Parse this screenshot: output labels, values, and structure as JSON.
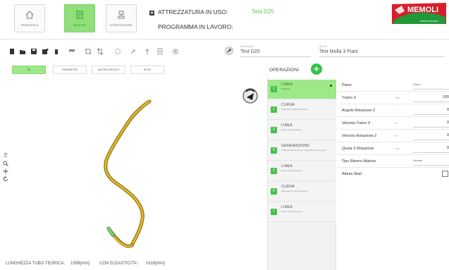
{
  "header": {
    "buttons": [
      {
        "label": "PRINCIPALE",
        "icon": "home-icon",
        "active": false
      },
      {
        "label": "RICETTE",
        "icon": "recipe-icon",
        "active": true
      },
      {
        "label": "ATTREZZATURE",
        "icon": "tooling-icon",
        "active": false
      }
    ],
    "tooling_label": "ATTREZZATURA IN USO:",
    "tooling_value": "Test D25",
    "program_label": "PROGRAMMA IN LAVORO:",
    "program_value": "",
    "logo_text": "MEMOLI",
    "logo_sub": "www.memoli.it",
    "accent": "#8fe07a"
  },
  "toolbar": {
    "icons": [
      "new-icon",
      "open-icon",
      "save-icon",
      "save-as-icon",
      "delete-icon",
      "ruler-icon",
      "crop-icon",
      "sort-icon",
      "rotate-icon",
      "pin-icon",
      "upload-icon",
      "copy-icon",
      "settings-icon"
    ],
    "tooling_field_label": "Attrezzatura",
    "tooling_field_value": "Test D25",
    "recipe_field_label": "Ricetta",
    "recipe_field_value": "Test Molla 3 Piani"
  },
  "subtabs": [
    "3D",
    "PARAMETRI",
    "VALORI DEFAULT",
    "NOTE"
  ],
  "canvas": {
    "length_label": "LUNGHEZZA TUBO TEORICA:",
    "length_value": "1599[mm]",
    "elastic_label": "CON ELEASTICITA':",
    "elastic_value": "1616[mm]"
  },
  "operations": {
    "title": "OPERAZIONI",
    "items": [
      {
        "n": "1",
        "name": "LINEA",
        "sub": "Generale",
        "active": true
      },
      {
        "n": "2",
        "name": "CURVA",
        "sub": "Parametri curva Operazione",
        "active": false
      },
      {
        "n": "3",
        "name": "LINEA",
        "sub": "Parametri Operazione",
        "active": false
      },
      {
        "n": "4",
        "name": "GENERAZIONE",
        "sub": "Posizione Generazione Programma a parametri",
        "active": false
      },
      {
        "n": "5",
        "name": "LINEA",
        "sub": "Parametri Operazione",
        "active": false
      },
      {
        "n": "6",
        "name": "CURVA",
        "sub": "Parametri curva Operazione",
        "active": false
      },
      {
        "n": "7",
        "name": "LINEA",
        "sub": "Parametri Operazione",
        "active": false
      }
    ]
  },
  "properties": [
    {
      "label": "Piano",
      "unit": "",
      "value": "",
      "select": "Piano 1"
    },
    {
      "label": "Traino X",
      "unit": "mm",
      "value": "100"
    },
    {
      "label": "Angolo Rotazione Z",
      "unit": "°",
      "value": "0"
    },
    {
      "label": "Velocita Traino X",
      "unit": "%",
      "value": "0"
    },
    {
      "label": "Velocita Rotazione Z",
      "unit": "%",
      "value": "0"
    },
    {
      "label": "Quota X Rotazione",
      "unit": "mm",
      "value": "0"
    },
    {
      "label": "Tipo Ritorno Matrice",
      "unit": "",
      "value": "",
      "select": "Normale"
    },
    {
      "label": "Attesa Start",
      "unit": "",
      "value": "",
      "checkbox": true
    }
  ],
  "view_tools": [
    "move-icon",
    "zoom-icon",
    "pan-icon",
    "reset-view-icon"
  ]
}
